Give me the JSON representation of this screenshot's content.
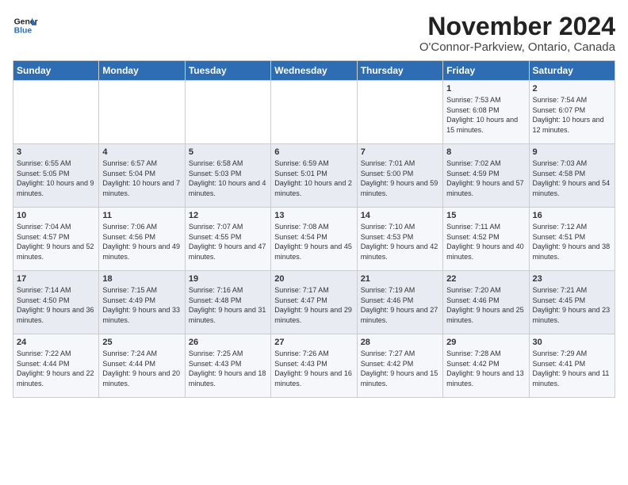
{
  "header": {
    "logo_line1": "General",
    "logo_line2": "Blue",
    "month": "November 2024",
    "location": "O'Connor-Parkview, Ontario, Canada"
  },
  "weekdays": [
    "Sunday",
    "Monday",
    "Tuesday",
    "Wednesday",
    "Thursday",
    "Friday",
    "Saturday"
  ],
  "weeks": [
    [
      {
        "day": "",
        "info": ""
      },
      {
        "day": "",
        "info": ""
      },
      {
        "day": "",
        "info": ""
      },
      {
        "day": "",
        "info": ""
      },
      {
        "day": "",
        "info": ""
      },
      {
        "day": "1",
        "info": "Sunrise: 7:53 AM\nSunset: 6:08 PM\nDaylight: 10 hours and 15 minutes."
      },
      {
        "day": "2",
        "info": "Sunrise: 7:54 AM\nSunset: 6:07 PM\nDaylight: 10 hours and 12 minutes."
      }
    ],
    [
      {
        "day": "3",
        "info": "Sunrise: 6:55 AM\nSunset: 5:05 PM\nDaylight: 10 hours and 9 minutes."
      },
      {
        "day": "4",
        "info": "Sunrise: 6:57 AM\nSunset: 5:04 PM\nDaylight: 10 hours and 7 minutes."
      },
      {
        "day": "5",
        "info": "Sunrise: 6:58 AM\nSunset: 5:03 PM\nDaylight: 10 hours and 4 minutes."
      },
      {
        "day": "6",
        "info": "Sunrise: 6:59 AM\nSunset: 5:01 PM\nDaylight: 10 hours and 2 minutes."
      },
      {
        "day": "7",
        "info": "Sunrise: 7:01 AM\nSunset: 5:00 PM\nDaylight: 9 hours and 59 minutes."
      },
      {
        "day": "8",
        "info": "Sunrise: 7:02 AM\nSunset: 4:59 PM\nDaylight: 9 hours and 57 minutes."
      },
      {
        "day": "9",
        "info": "Sunrise: 7:03 AM\nSunset: 4:58 PM\nDaylight: 9 hours and 54 minutes."
      }
    ],
    [
      {
        "day": "10",
        "info": "Sunrise: 7:04 AM\nSunset: 4:57 PM\nDaylight: 9 hours and 52 minutes."
      },
      {
        "day": "11",
        "info": "Sunrise: 7:06 AM\nSunset: 4:56 PM\nDaylight: 9 hours and 49 minutes."
      },
      {
        "day": "12",
        "info": "Sunrise: 7:07 AM\nSunset: 4:55 PM\nDaylight: 9 hours and 47 minutes."
      },
      {
        "day": "13",
        "info": "Sunrise: 7:08 AM\nSunset: 4:54 PM\nDaylight: 9 hours and 45 minutes."
      },
      {
        "day": "14",
        "info": "Sunrise: 7:10 AM\nSunset: 4:53 PM\nDaylight: 9 hours and 42 minutes."
      },
      {
        "day": "15",
        "info": "Sunrise: 7:11 AM\nSunset: 4:52 PM\nDaylight: 9 hours and 40 minutes."
      },
      {
        "day": "16",
        "info": "Sunrise: 7:12 AM\nSunset: 4:51 PM\nDaylight: 9 hours and 38 minutes."
      }
    ],
    [
      {
        "day": "17",
        "info": "Sunrise: 7:14 AM\nSunset: 4:50 PM\nDaylight: 9 hours and 36 minutes."
      },
      {
        "day": "18",
        "info": "Sunrise: 7:15 AM\nSunset: 4:49 PM\nDaylight: 9 hours and 33 minutes."
      },
      {
        "day": "19",
        "info": "Sunrise: 7:16 AM\nSunset: 4:48 PM\nDaylight: 9 hours and 31 minutes."
      },
      {
        "day": "20",
        "info": "Sunrise: 7:17 AM\nSunset: 4:47 PM\nDaylight: 9 hours and 29 minutes."
      },
      {
        "day": "21",
        "info": "Sunrise: 7:19 AM\nSunset: 4:46 PM\nDaylight: 9 hours and 27 minutes."
      },
      {
        "day": "22",
        "info": "Sunrise: 7:20 AM\nSunset: 4:46 PM\nDaylight: 9 hours and 25 minutes."
      },
      {
        "day": "23",
        "info": "Sunrise: 7:21 AM\nSunset: 4:45 PM\nDaylight: 9 hours and 23 minutes."
      }
    ],
    [
      {
        "day": "24",
        "info": "Sunrise: 7:22 AM\nSunset: 4:44 PM\nDaylight: 9 hours and 22 minutes."
      },
      {
        "day": "25",
        "info": "Sunrise: 7:24 AM\nSunset: 4:44 PM\nDaylight: 9 hours and 20 minutes."
      },
      {
        "day": "26",
        "info": "Sunrise: 7:25 AM\nSunset: 4:43 PM\nDaylight: 9 hours and 18 minutes."
      },
      {
        "day": "27",
        "info": "Sunrise: 7:26 AM\nSunset: 4:43 PM\nDaylight: 9 hours and 16 minutes."
      },
      {
        "day": "28",
        "info": "Sunrise: 7:27 AM\nSunset: 4:42 PM\nDaylight: 9 hours and 15 minutes."
      },
      {
        "day": "29",
        "info": "Sunrise: 7:28 AM\nSunset: 4:42 PM\nDaylight: 9 hours and 13 minutes."
      },
      {
        "day": "30",
        "info": "Sunrise: 7:29 AM\nSunset: 4:41 PM\nDaylight: 9 hours and 11 minutes."
      }
    ]
  ]
}
